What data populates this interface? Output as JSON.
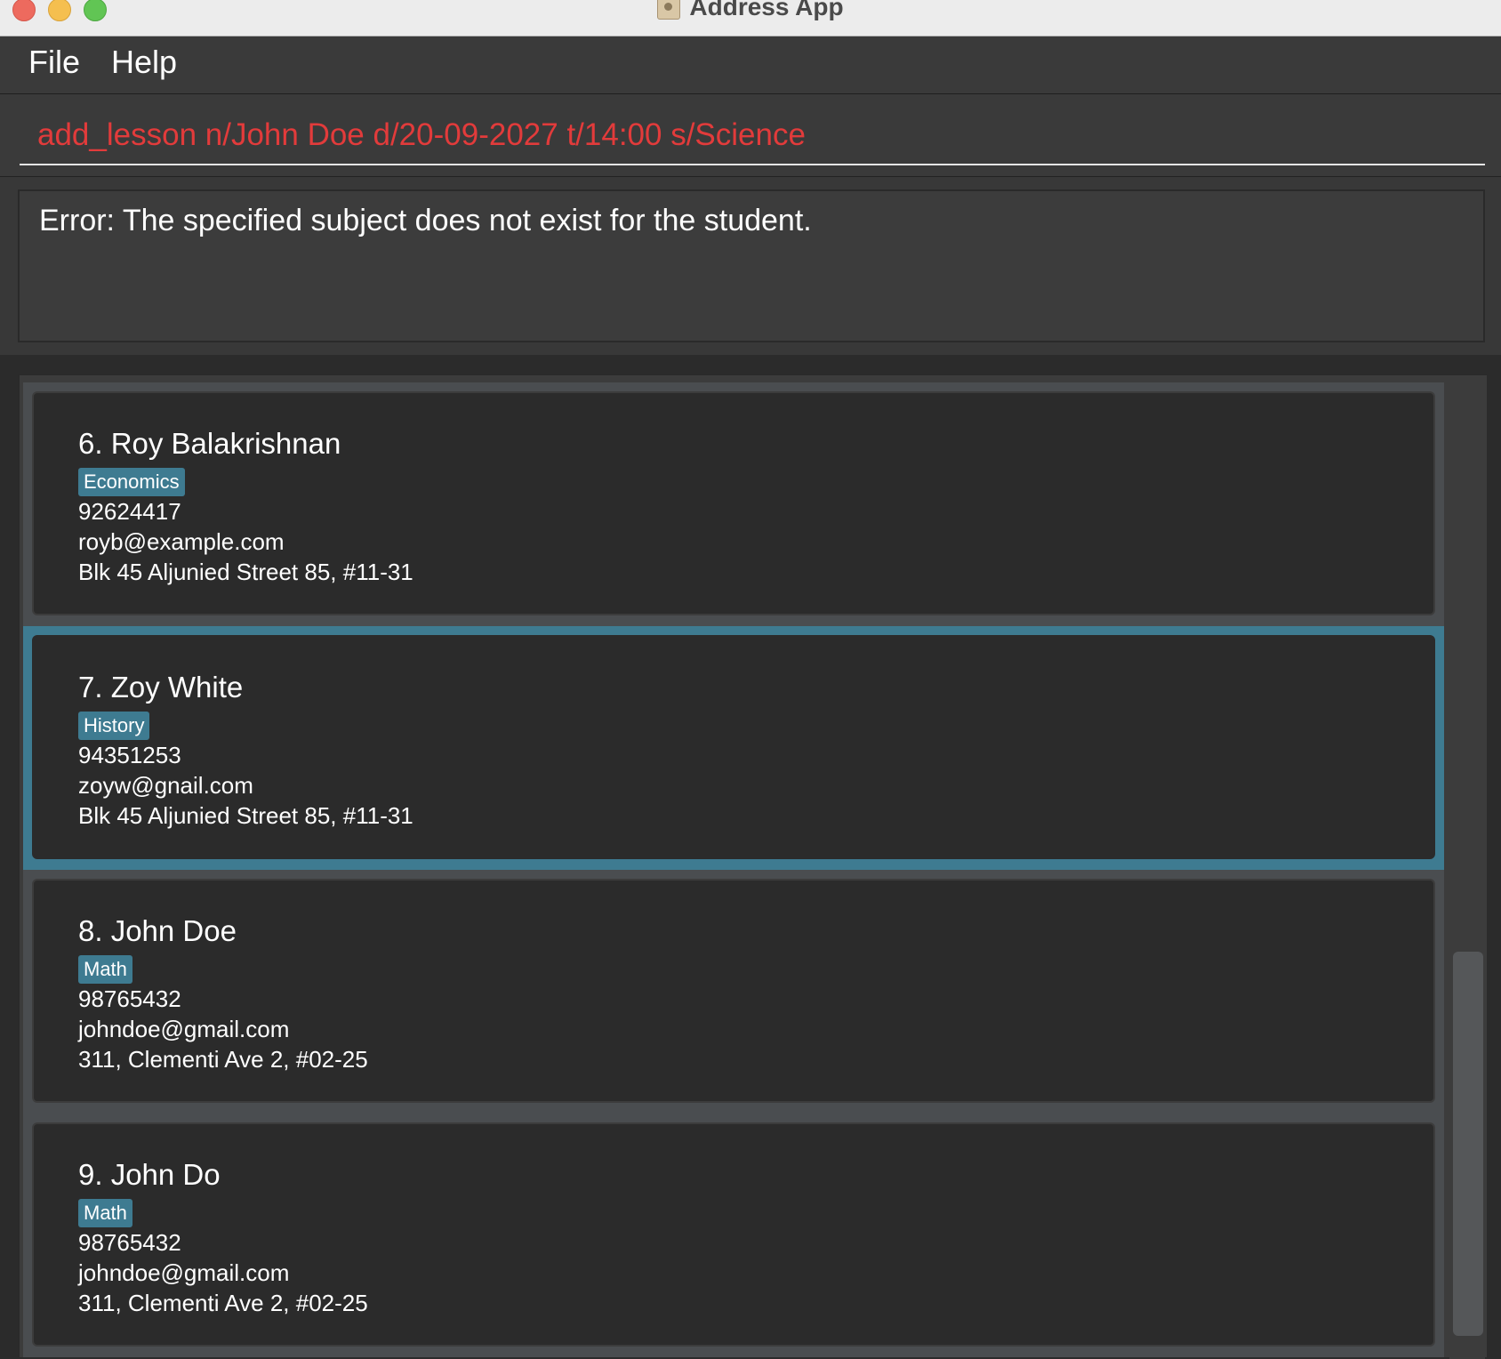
{
  "window": {
    "title": "Address App"
  },
  "menu": {
    "file": "File",
    "help": "Help"
  },
  "command": {
    "value": "add_lesson n/John Doe d/20-09-2027 t/14:00 s/Science"
  },
  "result": {
    "message": "Error: The specified subject does not exist for the student."
  },
  "persons": [
    {
      "name": "6. Roy Balakrishnan",
      "tag": "Economics",
      "phone": "92624417",
      "email": "royb@example.com",
      "address": "Blk 45 Aljunied Street 85, #11-31"
    },
    {
      "name": "7. Zoy White",
      "tag": "History",
      "phone": "94351253",
      "email": "zoyw@gnail.com",
      "address": "Blk 45 Aljunied Street 85, #11-31",
      "selected": true
    },
    {
      "name": "8. John Doe",
      "tag": "Math",
      "phone": "98765432",
      "email": "johndoe@gmail.com",
      "address": "311, Clementi Ave 2, #02-25"
    },
    {
      "name": "9. John Do",
      "tag": "Math",
      "phone": "98765432",
      "email": "johndoe@gmail.com",
      "address": "311, Clementi Ave 2, #02-25"
    }
  ],
  "colors": {
    "error_text": "#e23b3b",
    "tag_bg": "#3e7b91",
    "selected_border": "#3e7b91"
  }
}
